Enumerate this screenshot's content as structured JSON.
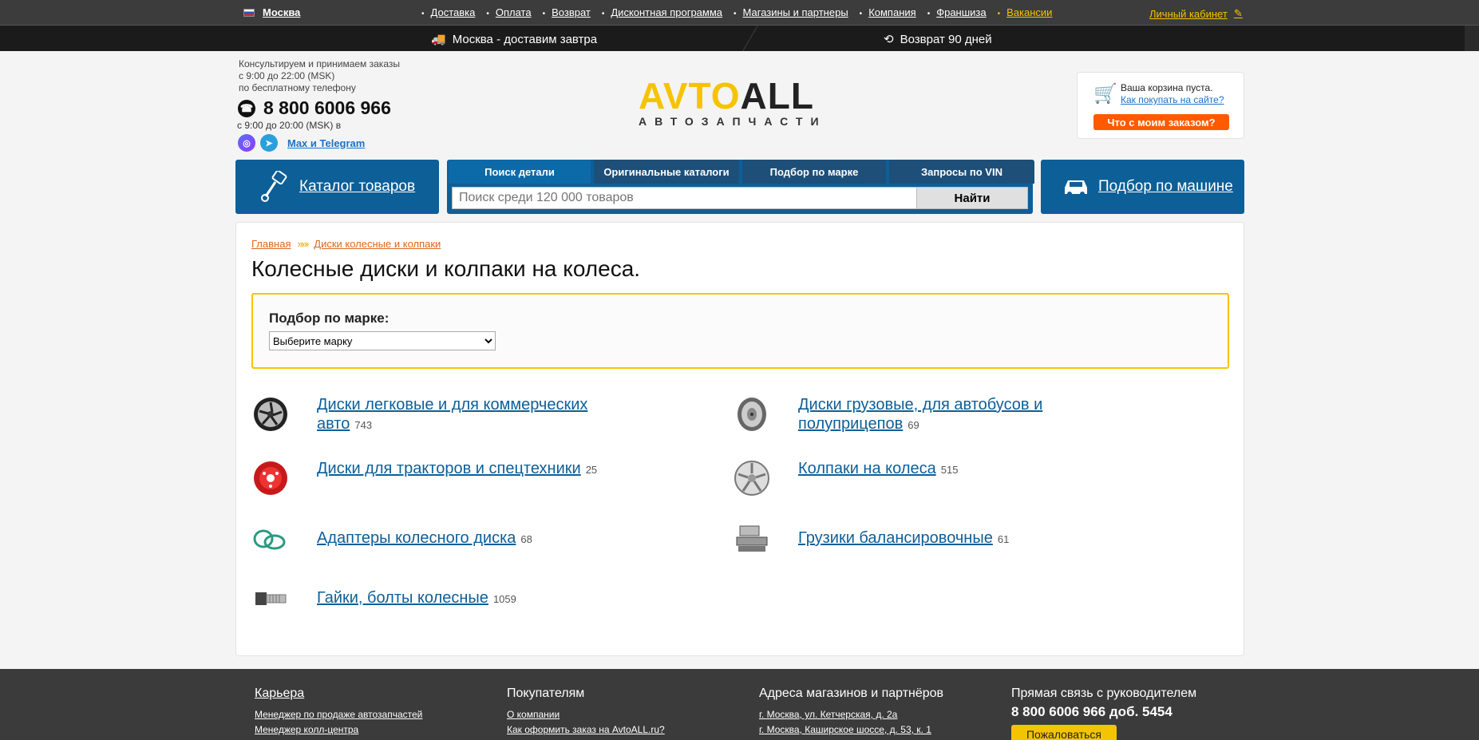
{
  "topbar": {
    "city": "Москва",
    "nav": [
      "Доставка",
      "Оплата",
      "Возврат",
      "Дисконтная программа",
      "Магазины и партнеры",
      "Компания",
      "Франшиза",
      "Вакансии"
    ],
    "cabinet": "Личный кабинет"
  },
  "strip": {
    "delivery": "Москва - доставим завтра",
    "return": "Возврат 90 дней"
  },
  "contacts": {
    "line1": "Консультируем и принимаем заказы",
    "line2": "с 9:00 до 22:00 (MSK)",
    "line3": "по бесплатному телефону",
    "phone": "8 800 6006 966",
    "hours2": "с 9:00 до 20:00 (MSK) в",
    "messengers": "Max и Telegram"
  },
  "logo": {
    "part1": "AVTO",
    "part2": "ALL",
    "sub": "АВТОЗАПЧАСТИ"
  },
  "cart": {
    "empty": "Ваша корзина пуста.",
    "how": "Как покупать на сайте?",
    "order_button": "Что с моим заказом?"
  },
  "nav": {
    "catalog": "Каталог товаров",
    "tabs": [
      "Поиск детали",
      "Оригинальные каталоги",
      "Подбор по марке",
      "Запросы по VIN"
    ],
    "search_placeholder": "Поиск среди 120 000 товаров",
    "search_button": "Найти",
    "pick_car": "Подбор по машине"
  },
  "breadcrumb": [
    "Главная",
    "Диски колесные и колпаки"
  ],
  "page_title": "Колесные диски и колпаки на колеса.",
  "brand_filter": {
    "label": "Подбор по марке:",
    "selected": "Выберите марку"
  },
  "categories": [
    {
      "name": "Диски легковые и для коммерческих авто",
      "count": "743",
      "icon": "alloy-wheel-icon"
    },
    {
      "name": "Диски грузовые, для автобусов и полуприцепов",
      "count": "69",
      "icon": "truck-wheel-icon"
    },
    {
      "name": "Диски для тракторов и спецтехники",
      "count": "25",
      "icon": "tractor-wheel-icon"
    },
    {
      "name": "Колпаки на колеса",
      "count": "515",
      "icon": "hubcap-icon"
    },
    {
      "name": "Адаптеры колесного диска",
      "count": "68",
      "icon": "adapter-icon"
    },
    {
      "name": "Грузики балансировочные",
      "count": "61",
      "icon": "weights-icon"
    },
    {
      "name": "Гайки, болты колесные",
      "count": "1059",
      "icon": "bolt-icon"
    }
  ],
  "footer": {
    "career": {
      "title": "Карьера",
      "links": [
        "Менеджер по продаже автозапчастей",
        "Менеджер колл-центра"
      ]
    },
    "buyers": {
      "title": "Покупателям",
      "links": [
        "О компании",
        "Как оформить заказ на AvtoALL.ru?"
      ]
    },
    "addresses": {
      "title": "Адреса магазинов и партнёров",
      "links": [
        "г. Москва, ул. Кетчерская, д. 2а",
        "г. Москва, Каширское шоссе, д. 53, к. 1"
      ]
    },
    "direct": {
      "title": "Прямая связь с руководителем",
      "phone": "8 800 6006 966 доб. 5454",
      "button": "Пожаловаться"
    }
  }
}
